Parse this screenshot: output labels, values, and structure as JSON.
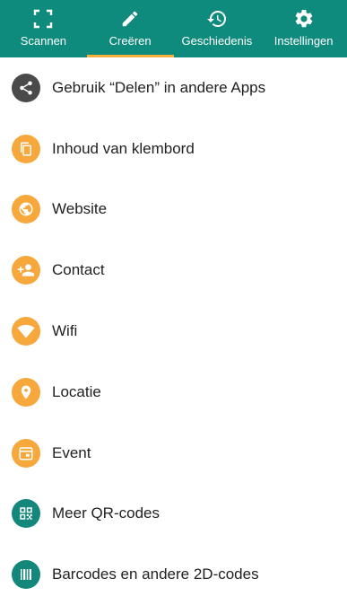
{
  "colors": {
    "topbar": "#0E8B7C",
    "indicator": "#F5B041",
    "share_icon_bg": "#4A4A4A",
    "orange": "#F6A83C",
    "teal": "#12877A"
  },
  "tabs": [
    {
      "label": "Scannen",
      "icon": "scan-frame-icon",
      "active": false
    },
    {
      "label": "Creëren",
      "icon": "pencil-icon",
      "active": true
    },
    {
      "label": "Geschiedenis",
      "icon": "history-icon",
      "active": false
    },
    {
      "label": "Instellingen",
      "icon": "gear-icon",
      "active": false
    }
  ],
  "items": [
    {
      "label": "Gebruik “Delen” in andere Apps",
      "icon": "share-icon",
      "color": "#4A4A4A"
    },
    {
      "label": "Inhoud van klembord",
      "icon": "clipboard-icon",
      "color": "#F6A83C"
    },
    {
      "label": "Website",
      "icon": "globe-icon",
      "color": "#F6A83C"
    },
    {
      "label": "Contact",
      "icon": "add-contact-icon",
      "color": "#F6A83C"
    },
    {
      "label": "Wifi",
      "icon": "wifi-icon",
      "color": "#F6A83C"
    },
    {
      "label": "Locatie",
      "icon": "location-pin-icon",
      "color": "#F6A83C"
    },
    {
      "label": "Event",
      "icon": "calendar-icon",
      "color": "#F6A83C"
    },
    {
      "label": "Meer QR-codes",
      "icon": "qr-code-icon",
      "color": "#12877A"
    },
    {
      "label": "Barcodes en andere 2D-codes",
      "icon": "barcode-icon",
      "color": "#12877A"
    }
  ]
}
